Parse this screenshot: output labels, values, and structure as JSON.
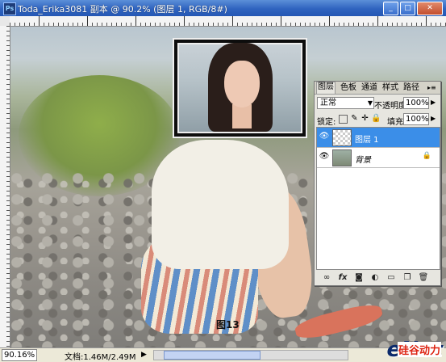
{
  "window": {
    "title": "Toda_Erika3081 副本 @ 90.2% (图层 1, RGB/8#)",
    "app_icon": "Ps",
    "minimize": "_",
    "maximize": "□",
    "close": "✕"
  },
  "canvas": {
    "caption": "图13"
  },
  "status": {
    "zoom": "90.16%",
    "doc": "文档:1.46M/2.49M",
    "arrow": "▶"
  },
  "watermark": {
    "main": "eNet",
    "sub": "硅谷动力"
  },
  "layers_panel": {
    "tabs": [
      "图层",
      "色板",
      "通道",
      "样式",
      "路径"
    ],
    "blend_mode": "正常",
    "opacity_label": "不透明度:",
    "opacity_value": "100%",
    "lock_label": "锁定:",
    "fill_label": "填充:",
    "fill_value": "100%",
    "layers": [
      {
        "name": "图层 1",
        "selected": true
      },
      {
        "name": "背景",
        "selected": false,
        "locked": true
      }
    ],
    "footer_icons": [
      "link-icon",
      "fx-icon",
      "mask-icon",
      "adjustment-icon",
      "group-icon",
      "new-layer-icon",
      "trash-icon"
    ]
  }
}
